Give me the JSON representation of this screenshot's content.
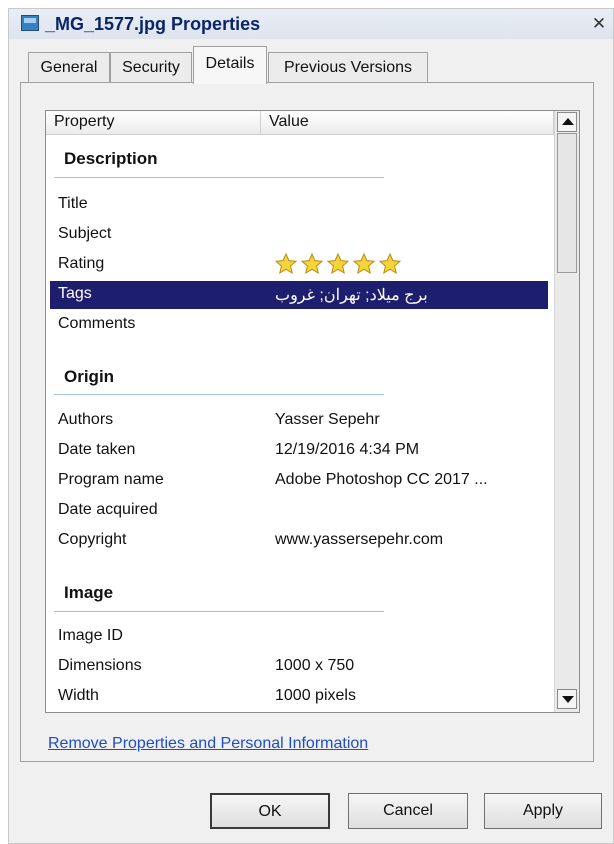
{
  "window": {
    "title": "_MG_1577.jpg Properties",
    "close_glyph": "✕"
  },
  "tabs": [
    {
      "label": "General"
    },
    {
      "label": "Security"
    },
    {
      "label": "Details"
    },
    {
      "label": "Previous Versions"
    }
  ],
  "details": {
    "columns": {
      "property": "Property",
      "value": "Value"
    },
    "sections": {
      "description": "Description",
      "origin": "Origin",
      "image": "Image"
    },
    "rows": {
      "title": {
        "label": "Title",
        "value": ""
      },
      "subject": {
        "label": "Subject",
        "value": ""
      },
      "rating": {
        "label": "Rating",
        "value": 5,
        "max": 5
      },
      "tags": {
        "label": "Tags",
        "value": "برج میلاد; تهران; غروب"
      },
      "comments": {
        "label": "Comments",
        "value": ""
      },
      "authors": {
        "label": "Authors",
        "value": "Yasser Sepehr"
      },
      "date_taken": {
        "label": "Date taken",
        "value": "12/19/2016 4:34 PM"
      },
      "program_name": {
        "label": "Program name",
        "value": "Adobe Photoshop CC 2017 ..."
      },
      "date_acquired": {
        "label": "Date acquired",
        "value": ""
      },
      "copyright": {
        "label": "Copyright",
        "value": "www.yassersepehr.com"
      },
      "image_id": {
        "label": "Image ID",
        "value": ""
      },
      "dimensions": {
        "label": "Dimensions",
        "value": "1000 x 750"
      },
      "width": {
        "label": "Width",
        "value": "1000 pixels"
      }
    },
    "selected_row": "Tags"
  },
  "link": "Remove Properties and Personal Information",
  "buttons": {
    "ok": "OK",
    "cancel": "Cancel",
    "apply": "Apply"
  },
  "colors": {
    "selection": "#1e1e6e",
    "star": "#f5d33a",
    "link": "#1f4fbf"
  }
}
